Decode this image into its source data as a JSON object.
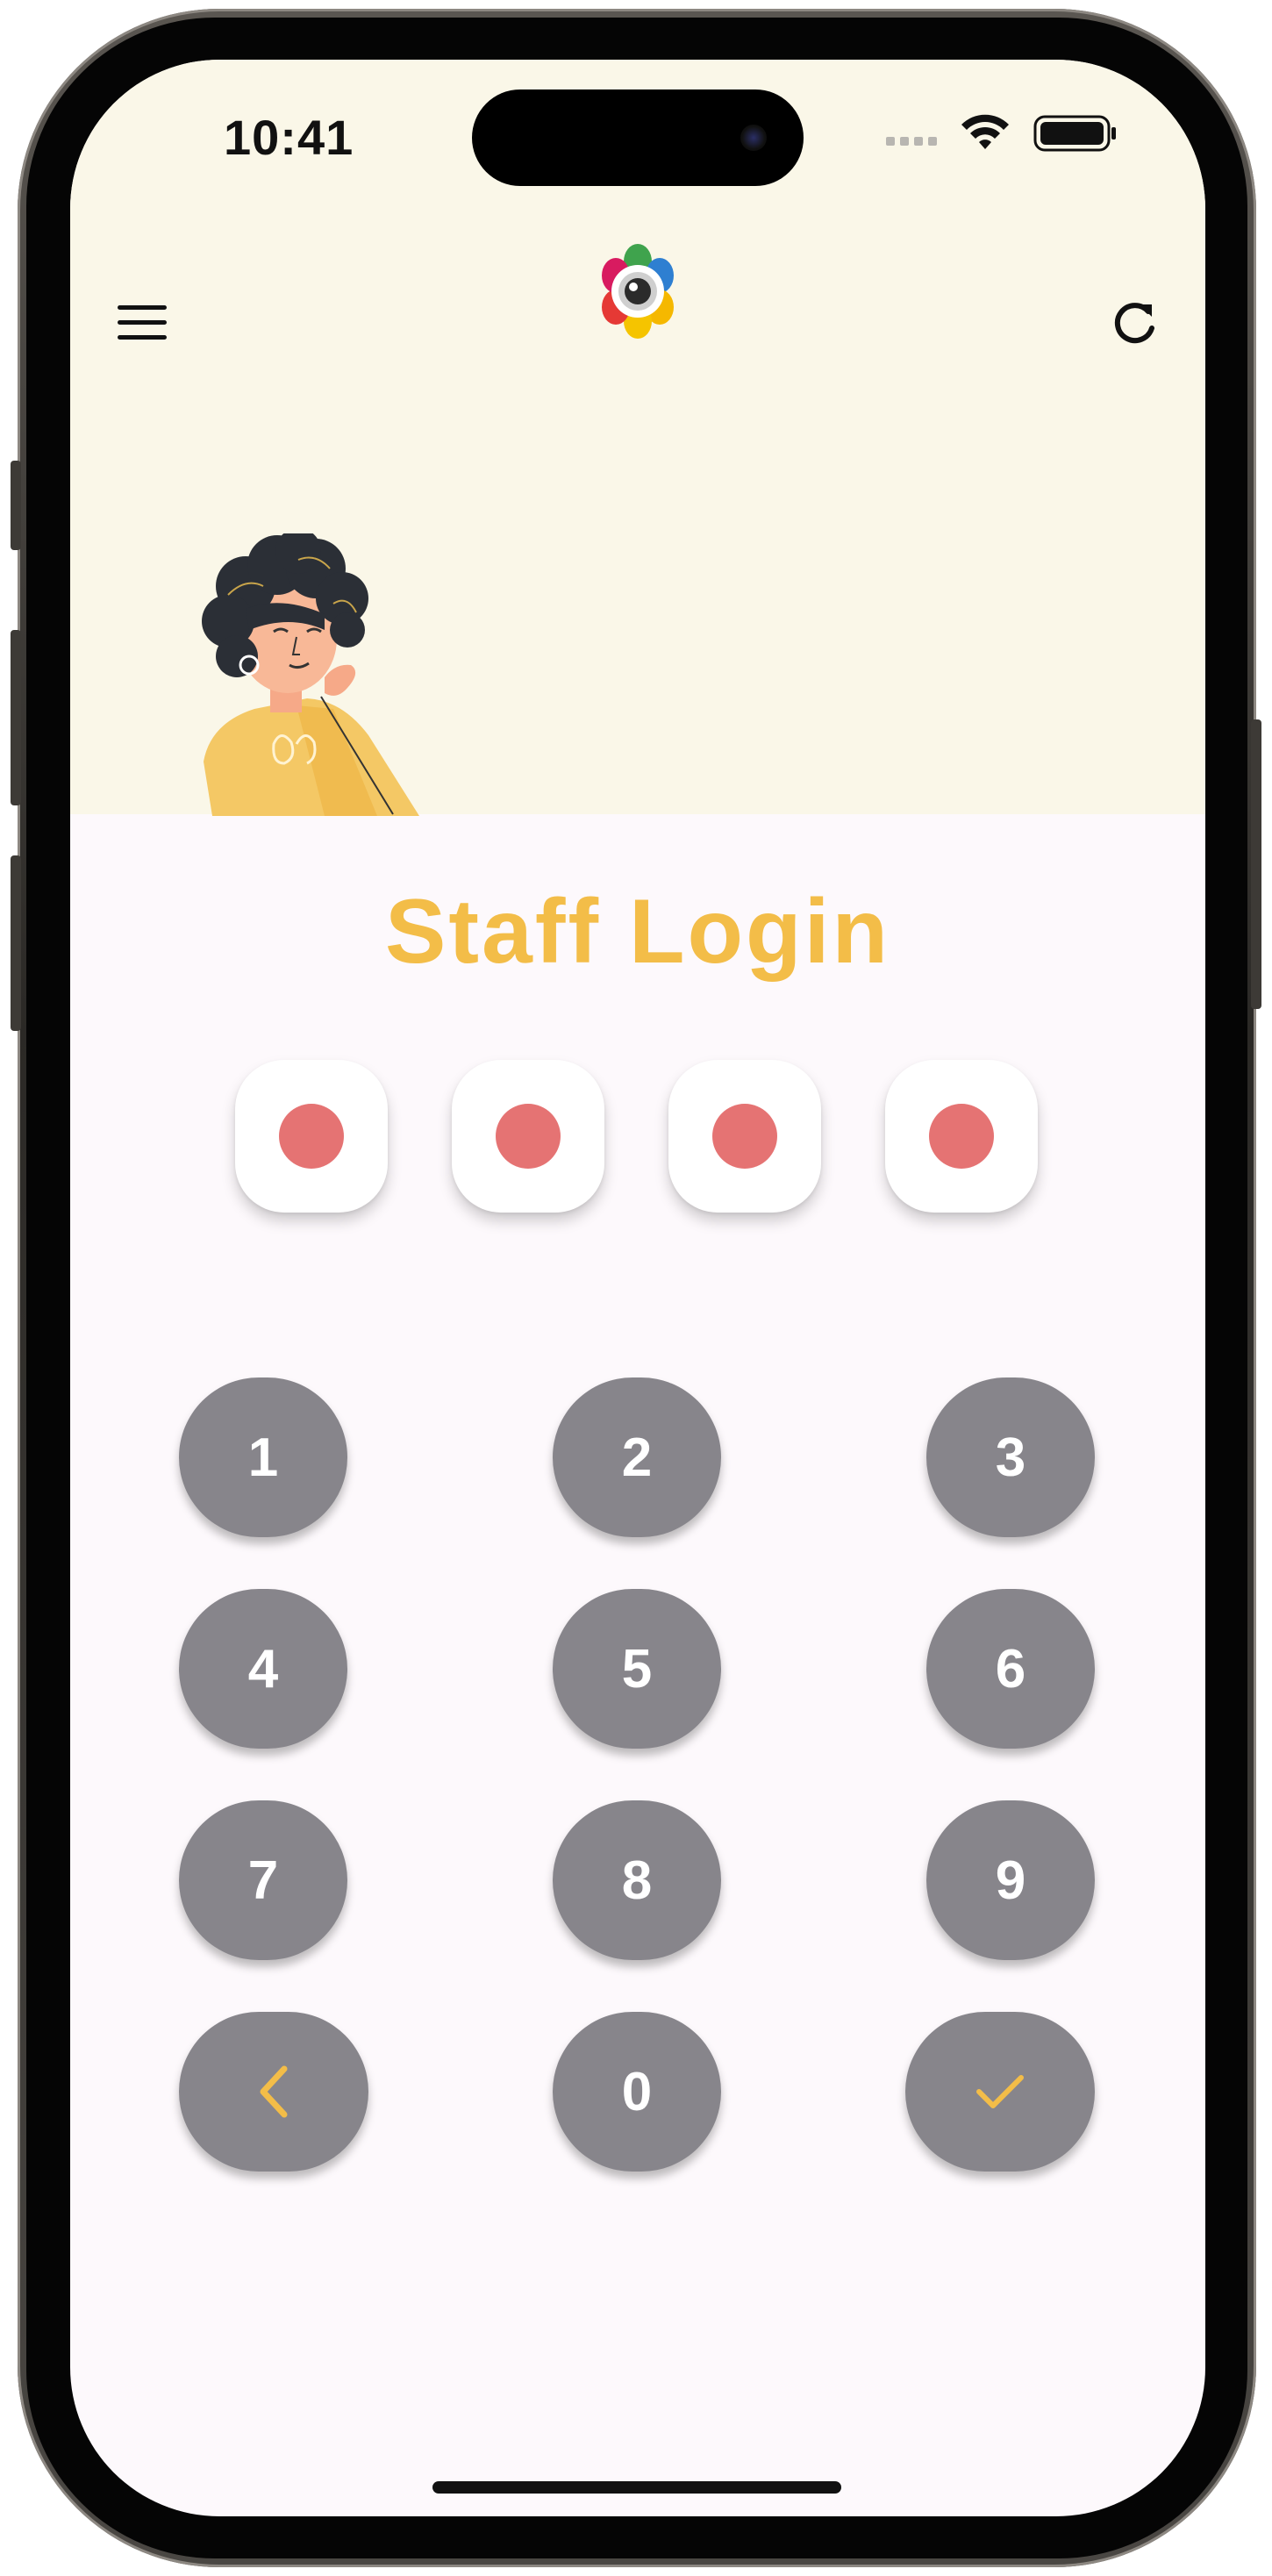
{
  "status_bar": {
    "time": "10:41"
  },
  "header": {
    "menu_icon": "hamburger-menu-icon",
    "logo": "camera-flower-logo",
    "refresh_icon": "refresh-icon"
  },
  "illustration": "woman-thinking-illustration",
  "login": {
    "title": "Staff Login",
    "pin_filled_count": 4,
    "pin_length": 4
  },
  "keypad": {
    "keys": [
      "1",
      "2",
      "3",
      "4",
      "5",
      "6",
      "7",
      "8",
      "9",
      "0"
    ],
    "back_icon": "chevron-left-icon",
    "confirm_icon": "checkmark-icon"
  },
  "colors": {
    "accent": "#f3bd48",
    "pin_dot": "#e57373",
    "key_bg": "#87858b",
    "header_bg": "#faf7e8",
    "body_bg": "#fdf9fc"
  }
}
